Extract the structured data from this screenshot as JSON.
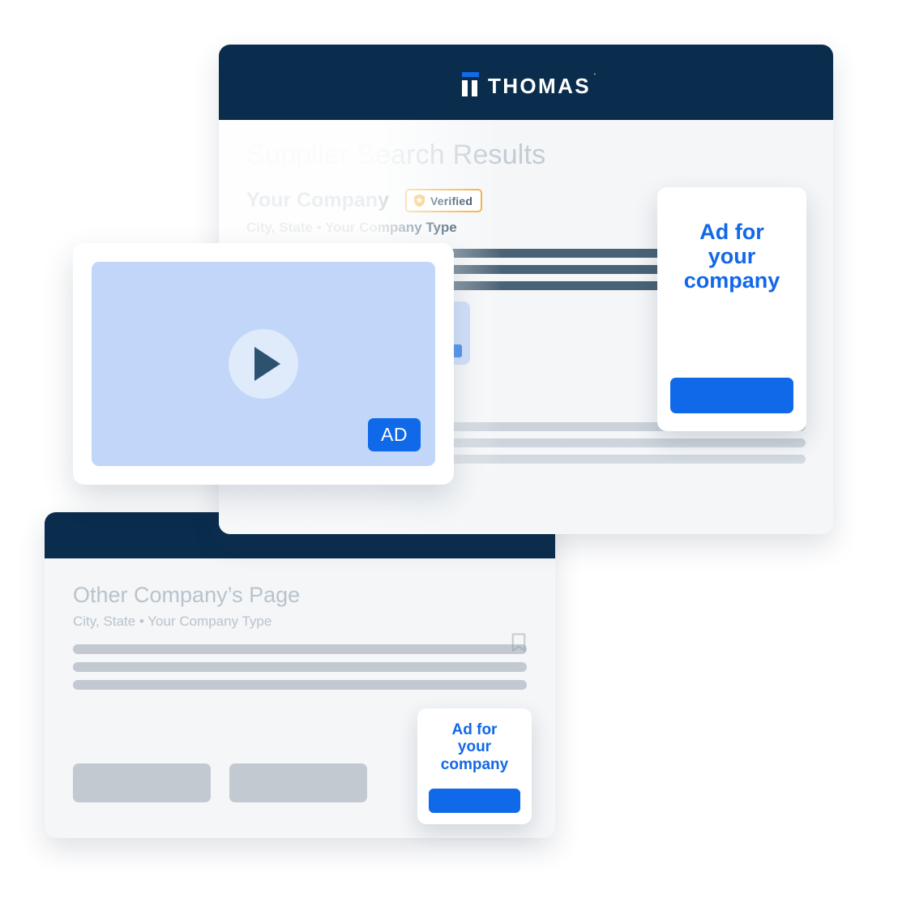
{
  "brand": {
    "logo_text": "THOMAS",
    "logo_trademark": "˙",
    "navy": "#0b2d4d",
    "accent_blue": "#1069e8",
    "verified_orange": "#f0a62c"
  },
  "results_card": {
    "page_title": "Supplier Search Results",
    "listing": {
      "company_name": "Your Company",
      "verified_label": "Verified",
      "verified_icon": "shield-star-icon",
      "bookmark_icon": "bookmark-icon",
      "meta": "City, State  •  Your Company Type"
    },
    "listing_faded": {
      "meta_fragment": "Type",
      "bookmark_icon": "bookmark-icon"
    }
  },
  "ad_large": {
    "headline_line1": "Ad for",
    "headline_line2": "your",
    "headline_line3": "company",
    "cta_label": ""
  },
  "ad_small": {
    "headline_line1": "Ad for",
    "headline_line2": "your",
    "headline_line3": "company",
    "cta_label": ""
  },
  "video_ad": {
    "play_icon": "play-icon",
    "ad_badge": "AD"
  },
  "other_card": {
    "title": "Other Company’s Page",
    "meta": "City, State  •  Your Company Type",
    "bookmark_icon": "bookmark-icon"
  }
}
